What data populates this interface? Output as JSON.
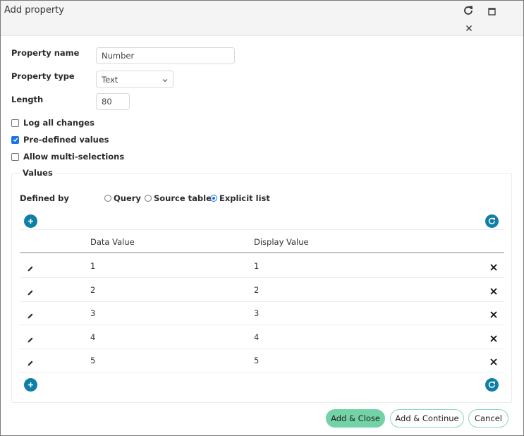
{
  "window": {
    "title": "Add property",
    "icons": [
      "refresh-icon",
      "maximize-icon",
      "close-icon"
    ]
  },
  "form": {
    "property_name": {
      "label": "Property name",
      "value": "Number"
    },
    "property_type": {
      "label": "Property type",
      "selected": "Text"
    },
    "length": {
      "label": "Length",
      "value": "80"
    },
    "checkboxes": [
      {
        "label": "Log all changes",
        "checked": false
      },
      {
        "label": "Pre-defined values",
        "checked": true
      },
      {
        "label": "Allow multi-selections",
        "checked": false
      }
    ]
  },
  "values": {
    "legend": "Values",
    "defined_by_label": "Defined by",
    "options": [
      {
        "label": "Query",
        "selected": false
      },
      {
        "label": "Source table",
        "selected": false
      },
      {
        "label": "Explicit list",
        "selected": true
      }
    ],
    "table": {
      "columns": [
        "Data Value",
        "Display Value"
      ],
      "rows": [
        {
          "data": "1",
          "display": "1"
        },
        {
          "data": "2",
          "display": "2"
        },
        {
          "data": "3",
          "display": "3"
        },
        {
          "data": "4",
          "display": "4"
        },
        {
          "data": "5",
          "display": "5"
        }
      ]
    }
  },
  "footer": {
    "add_close": "Add & Close",
    "add_continue": "Add & Continue",
    "cancel": "Cancel"
  },
  "colors": {
    "accent_blue": "#0e7fa6",
    "primary_green": "#73d3a7",
    "checkbox_blue": "#1a73e8"
  }
}
